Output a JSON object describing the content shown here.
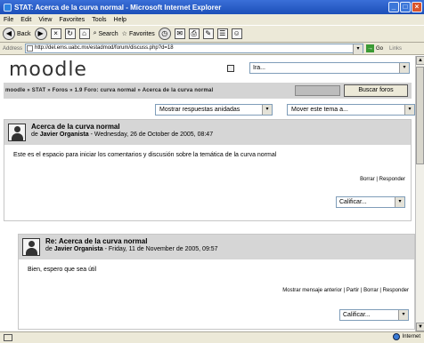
{
  "window": {
    "title": "STAT: Acerca de la curva normal - Microsoft Internet Explorer",
    "controls": [
      "_",
      "□",
      "×"
    ]
  },
  "menu": [
    "File",
    "Edit",
    "View",
    "Favorites",
    "Tools",
    "Help"
  ],
  "toolbar": {
    "back": "Back",
    "search": "Search",
    "favorites": "Favorites"
  },
  "address": {
    "label": "Address",
    "url": "http://del.ems.uabc.mx/estadmod/forum/discuss.php?d=18",
    "go": "Go",
    "links": "Links"
  },
  "header": {
    "logo": "moodle",
    "language": "Ira..."
  },
  "nav": {
    "breadcrumb": "moodle » STAT » Foros » 1.9 Foro: curva normal » Acerca de la curva normal",
    "search_button": "Buscar foros"
  },
  "controls": {
    "display_mode": "Mostrar respuestas anidadas",
    "move_topic": "Mover este tema a..."
  },
  "posts": [
    {
      "subject": "Acerca de la curva normal",
      "by": "de",
      "author": "Javier Organista",
      "date": "Wednesday, 26 de October de 2005, 08:47",
      "text": "Este es el espacio para iniciar los comentarios y discusión sobre la temática de la curva normal",
      "links": "Borrar | Responder",
      "rating": "Calificar..."
    },
    {
      "subject": "Re: Acerca de la curva normal",
      "by": "de",
      "author": "Javier Organista",
      "date": "Friday, 11 de November de 2005, 09:57",
      "text": "Bien, espero que sea útil",
      "links": "Mostrar mensaje anterior | Partir | Borrar | Responder",
      "rating": "Calificar..."
    }
  ],
  "status": {
    "zone": "Internet"
  }
}
